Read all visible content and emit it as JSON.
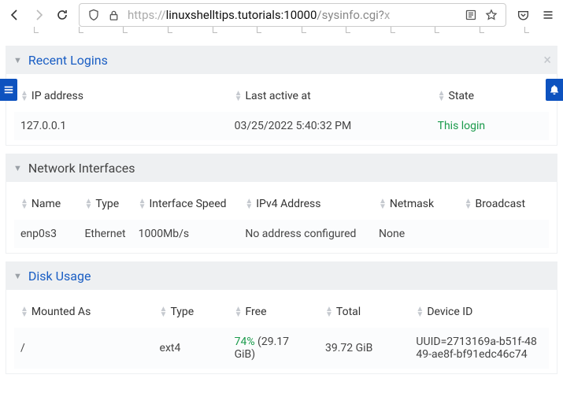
{
  "browser": {
    "url_prefix": "https://",
    "url_bold": "linuxshelltips.tutorials",
    "url_port": ":10000",
    "url_path": "/sysinfo.cgi?",
    "url_trunc": "x"
  },
  "panels": {
    "recent_logins": {
      "title": "Recent Logins",
      "cols": {
        "ip": "IP address",
        "last": "Last active at",
        "state": "State"
      },
      "row": {
        "ip": "127.0.0.1",
        "last": "03/25/2022 5:40:32 PM",
        "state": "This login"
      }
    },
    "network": {
      "title": "Network Interfaces",
      "cols": {
        "name": "Name",
        "type": "Type",
        "speed": "Interface Speed",
        "ipv4": "IPv4 Address",
        "mask": "Netmask",
        "bcast": "Broadcast"
      },
      "row": {
        "name": "enp0s3",
        "type": "Ethernet",
        "speed": "1000Mb/s",
        "ipv4": "No address configured",
        "mask": "None",
        "bcast": ""
      }
    },
    "disk": {
      "title": "Disk Usage",
      "cols": {
        "mount": "Mounted As",
        "type": "Type",
        "free": "Free",
        "total": "Total",
        "dev": "Device ID"
      },
      "row": {
        "mount": "/",
        "type": "ext4",
        "free_pct": "74%",
        "free_size": " (29.17 GiB)",
        "total": "39.72 GiB",
        "dev": "UUID=2713169a-b51f-4849-ae8f-bf91edc46c74"
      }
    }
  }
}
